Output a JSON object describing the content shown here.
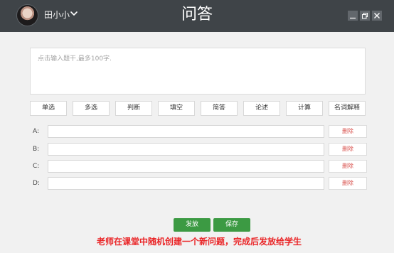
{
  "header": {
    "user_name": "田小小",
    "title": "问答"
  },
  "question": {
    "placeholder": "点击输入题干,最多100字."
  },
  "question_types": [
    "单选",
    "多选",
    "判断",
    "填空",
    "简答",
    "论述",
    "计算",
    "名词解释"
  ],
  "options": [
    {
      "label": "A:",
      "delete_label": "删除"
    },
    {
      "label": "B:",
      "delete_label": "删除"
    },
    {
      "label": "C:",
      "delete_label": "删除"
    },
    {
      "label": "D:",
      "delete_label": "删除"
    }
  ],
  "footer": {
    "publish_label": "发放",
    "save_label": "保存",
    "caption": "老师在课堂中随机创建一个新问题，完成后发放给学生"
  }
}
